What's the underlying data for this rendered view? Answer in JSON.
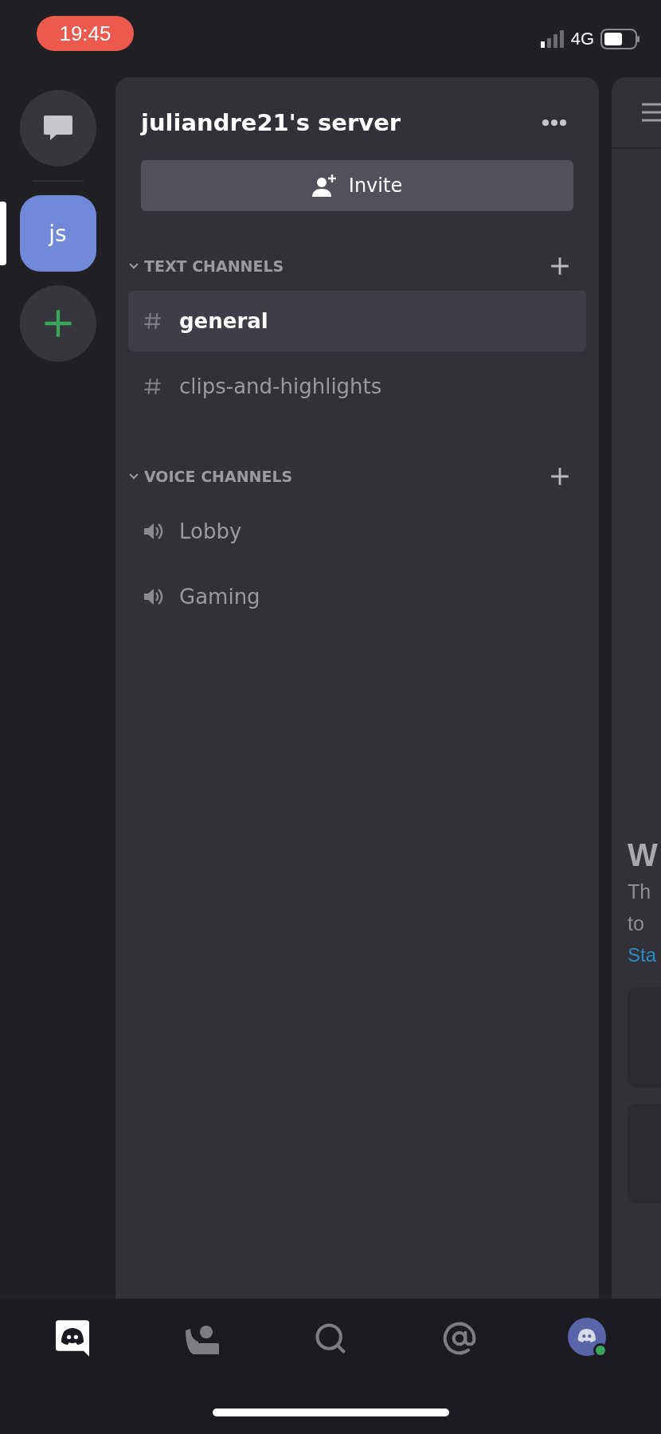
{
  "status_bar": {
    "time": "19:45",
    "network": "4G"
  },
  "server_rail": [
    {
      "kind": "dm",
      "selected": false
    },
    {
      "kind": "server",
      "label": "js",
      "selected": true
    },
    {
      "kind": "add",
      "selected": false
    }
  ],
  "server": {
    "name": "juliandre21's server",
    "invite_label": "Invite",
    "categories": [
      {
        "name": "TEXT CHANNELS",
        "channels": [
          {
            "name": "general",
            "kind": "text",
            "selected": true
          },
          {
            "name": "clips-and-highlights",
            "kind": "text",
            "selected": false
          }
        ]
      },
      {
        "name": "VOICE CHANNELS",
        "channels": [
          {
            "name": "Lobby",
            "kind": "voice",
            "selected": false
          },
          {
            "name": "Gaming",
            "kind": "voice",
            "selected": false
          }
        ]
      }
    ]
  },
  "chat_panel": {
    "heading": "W",
    "lines": [
      "Th",
      "to"
    ],
    "link": "Sta"
  },
  "tab_bar": [
    {
      "kind": "home",
      "selected": true
    },
    {
      "kind": "friends",
      "selected": false
    },
    {
      "kind": "search",
      "selected": false
    },
    {
      "kind": "mentions",
      "selected": false
    },
    {
      "kind": "profile",
      "selected": false
    }
  ]
}
